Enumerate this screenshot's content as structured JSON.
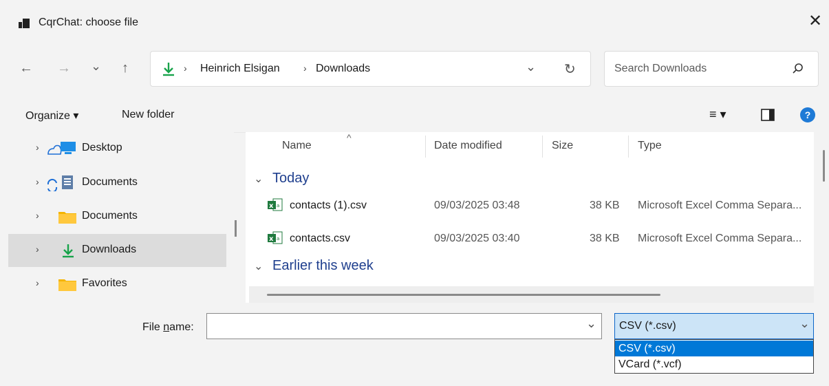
{
  "window": {
    "title": "CqrChat: choose file",
    "close_glyph": "✕"
  },
  "nav": {
    "back": "←",
    "forward": "→",
    "recent": "⌄",
    "up": "↑"
  },
  "address": {
    "crumbs": [
      "Heinrich Elsigan",
      "Downloads"
    ],
    "dropdown": "⌄",
    "refresh": "↻"
  },
  "search": {
    "placeholder": "Search Downloads",
    "icon": "⚲"
  },
  "commands": {
    "organize": "Organize ▾",
    "new_folder": "New folder",
    "view": "≡ ▾",
    "help": "?"
  },
  "tree": {
    "items": [
      {
        "label": "Desktop",
        "icon": "onedrive-desktop-icon",
        "selected": false
      },
      {
        "label": "Documents",
        "icon": "sync-documents-icon",
        "selected": false
      },
      {
        "label": "Documents",
        "icon": "folder-icon",
        "selected": false
      },
      {
        "label": "Downloads",
        "icon": "download-icon",
        "selected": true
      },
      {
        "label": "Favorites",
        "icon": "folder-icon",
        "selected": false
      }
    ]
  },
  "columns": {
    "name": "Name",
    "date": "Date modified",
    "size": "Size",
    "type": "Type"
  },
  "groups": {
    "today": "Today",
    "earlier": "Earlier this week"
  },
  "files": [
    {
      "name": "contacts (1).csv",
      "date": "09/03/2025 03:48",
      "size": "38 KB",
      "type": "Microsoft Excel Comma Separa..."
    },
    {
      "name": "contacts.csv",
      "date": "09/03/2025 03:40",
      "size": "38 KB",
      "type": "Microsoft Excel Comma Separa..."
    }
  ],
  "footer": {
    "file_name_label": "File name:",
    "file_name_value": "",
    "file_type_selected": "CSV (*.csv)",
    "file_type_options": [
      "CSV (*.csv)",
      "VCard (*.vcf)"
    ]
  },
  "colors": {
    "accent": "#0078d7",
    "group_text": "#1f3f8e",
    "download_green": "#17a34a",
    "folder_yellow": "#f4b400"
  }
}
